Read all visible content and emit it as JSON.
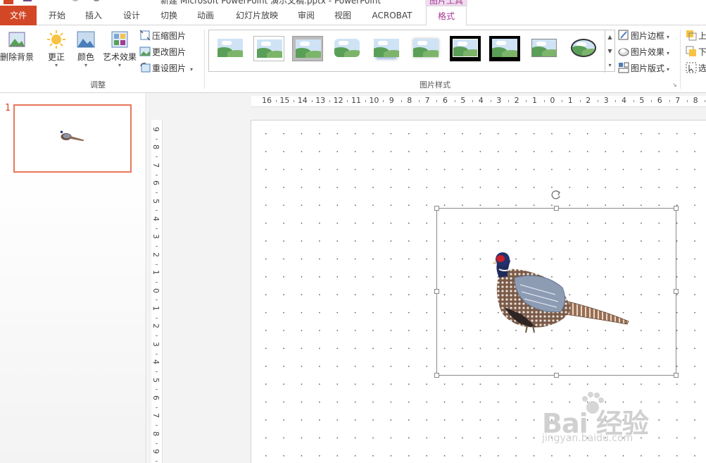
{
  "window": {
    "title": "新建 Microsoft PowerPoint 演示文稿.pptx - PowerPoint",
    "context_tab_group": "图片工具"
  },
  "tabs": [
    {
      "label": "文件",
      "kind": "file"
    },
    {
      "label": "开始"
    },
    {
      "label": "插入"
    },
    {
      "label": "设计"
    },
    {
      "label": "切换"
    },
    {
      "label": "动画"
    },
    {
      "label": "幻灯片放映"
    },
    {
      "label": "审阅"
    },
    {
      "label": "视图"
    },
    {
      "label": "ACROBAT"
    },
    {
      "label": "格式",
      "active": true
    }
  ],
  "ribbon": {
    "adjust": {
      "remove_bg": "删除背景",
      "corrections": "更正",
      "color": "颜色",
      "artistic": "艺术效果",
      "compress": "压缩图片",
      "change": "更改图片",
      "reset": "重设图片",
      "group_label": "调整"
    },
    "styles": {
      "group_label": "图片样式",
      "border": "图片边框",
      "effects": "图片效果",
      "layout": "图片版式"
    },
    "arrange": {
      "bring_forward": "上",
      "send_backward": "下",
      "selection_pane": "选"
    }
  },
  "slides_pane": {
    "slide_number": "1"
  },
  "rulers": {
    "horizontal": [
      "16",
      "15",
      "14",
      "13",
      "12",
      "11",
      "10",
      "9",
      "8",
      "7",
      "6",
      "5",
      "4",
      "3",
      "2",
      "1",
      "0",
      "1",
      "2",
      "3",
      "4",
      "5",
      "6",
      "7",
      "8"
    ],
    "vertical": [
      "9",
      "8",
      "7",
      "6",
      "5",
      "4",
      "3",
      "2",
      "1",
      "0",
      "1",
      "2",
      "3",
      "4",
      "5",
      "6",
      "7",
      "8",
      "9"
    ]
  },
  "watermark": {
    "main": "Bai 经验",
    "sub": "jingyan.baidu.com"
  },
  "colors": {
    "file_tab": "#d24726",
    "context_accent": "#a33a95",
    "thumb_border": "#e8765a"
  }
}
